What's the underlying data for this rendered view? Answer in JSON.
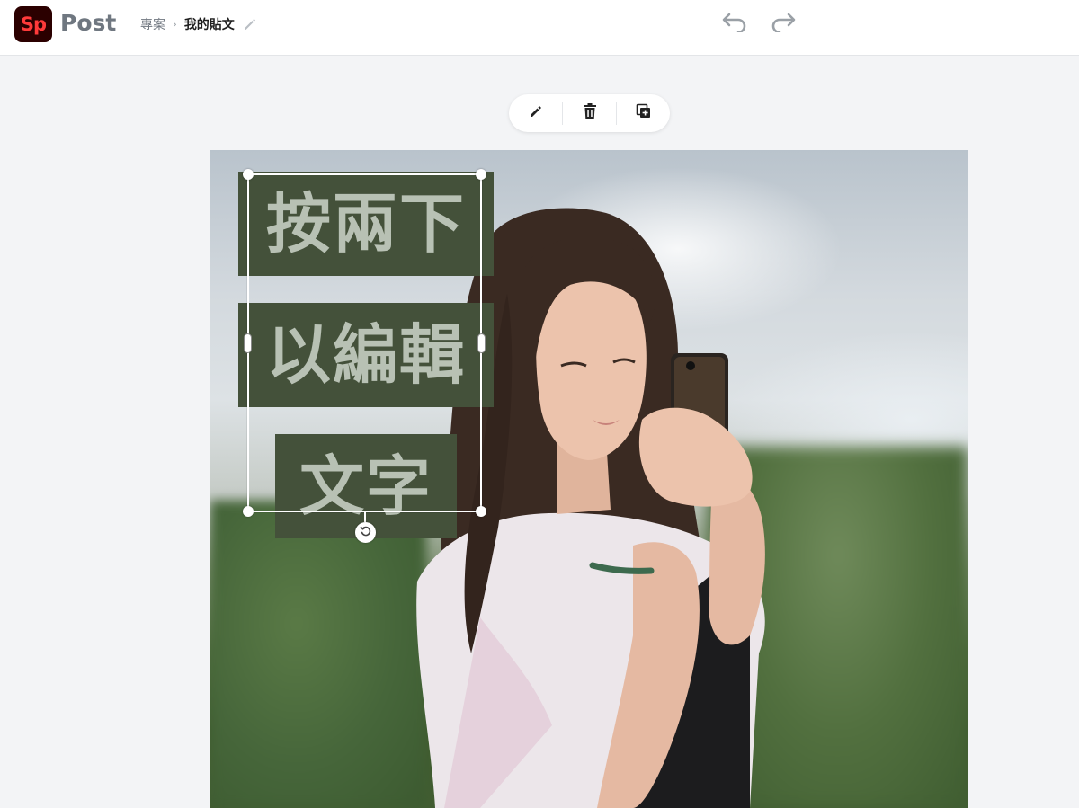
{
  "app": {
    "logo_text": "Sp",
    "name": "Post"
  },
  "breadcrumb": {
    "parent": "專案",
    "separator": "›",
    "current": "我的貼文"
  },
  "history": {
    "undo_icon": "undo-icon",
    "redo_icon": "redo-icon"
  },
  "toolbar": {
    "items": [
      "pencil-icon",
      "trash-icon",
      "duplicate-icon"
    ]
  },
  "canvas": {
    "text_lines": [
      "按兩下",
      "以編輯",
      "文字"
    ]
  },
  "colors": {
    "text_block_bg": "#44513a",
    "text_block_fg": "#b8c1b4",
    "logo_bg": "#2b0000",
    "logo_fg": "#ff3a3a"
  }
}
